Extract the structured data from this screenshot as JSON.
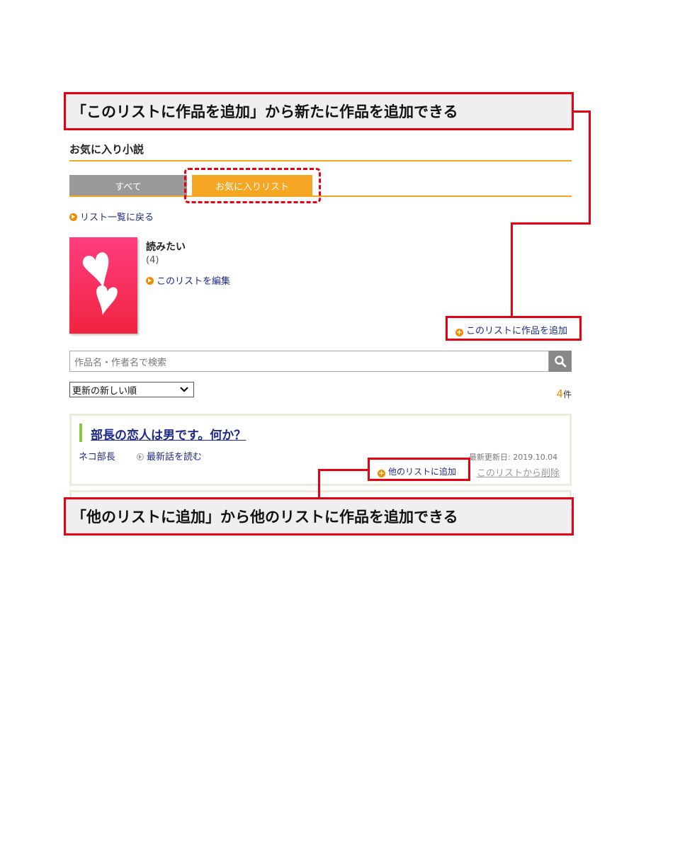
{
  "callouts": {
    "top": "「このリストに作品を追加」から新たに作品を追加できる",
    "bottom": "「他のリストに追加」から他のリストに作品を追加できる"
  },
  "header": {
    "title": "お気に入り小説"
  },
  "tabs": [
    {
      "label": "すべて",
      "active": false
    },
    {
      "label": "お気に入りリスト",
      "active": true
    }
  ],
  "nav": {
    "back_link": "リスト一覧に戻る"
  },
  "list": {
    "name": "読みたい",
    "count": "(4)",
    "edit_link": "このリストを編集",
    "add_work_link": "このリストに作品を追加"
  },
  "search": {
    "placeholder": "作品名・作者名で検索",
    "icon": "search-icon"
  },
  "sort": {
    "selected": "更新の新しい順"
  },
  "results": {
    "count": "4",
    "unit": "件"
  },
  "items": [
    {
      "title": "部長の恋人は男です。何か？",
      "author": "ネコ部長",
      "latest_link": "最新話を読む",
      "updated_label": "最新更新日: 2019.10.04",
      "add_other_link": "他のリストに追加",
      "remove_link": "このリストから削除"
    }
  ],
  "colors": {
    "accent_orange": "#f5a623",
    "callout_red": "#e60012",
    "link_blue": "#1d2a8c",
    "marker_green": "#8dc63f"
  }
}
